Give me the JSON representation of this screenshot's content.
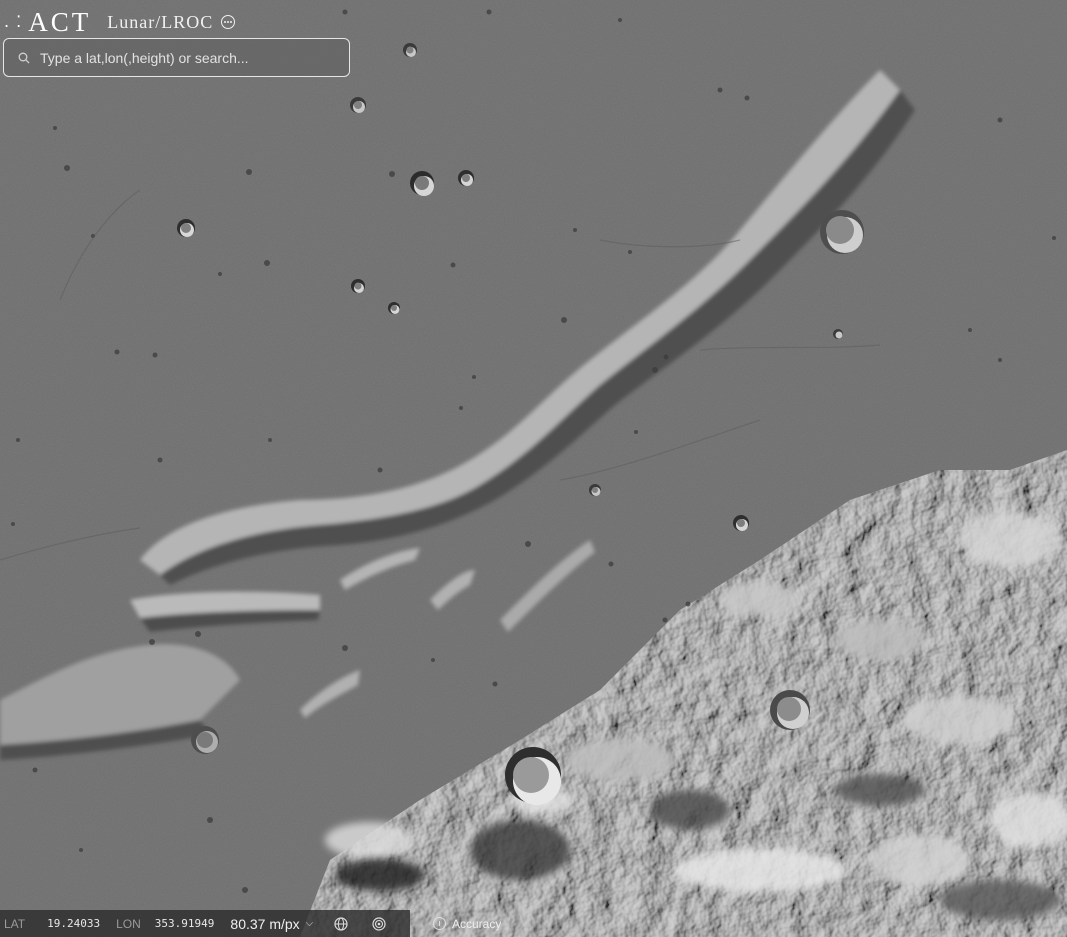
{
  "app": {
    "brand_mark": ". ⁚",
    "brand_name": "ACT",
    "layer_name": "Lunar/LROC",
    "layer_menu_icon": "more-circle-icon"
  },
  "search": {
    "placeholder": "Type a lat,lon(,height) or search...",
    "value": "",
    "icon": "search-icon"
  },
  "status": {
    "lat_label": "LAT",
    "lat_value": "19.24033",
    "lon_label": "LON",
    "lon_value": "353.91949",
    "scale_value": "80.37 m/px",
    "scale_caret": "⌵",
    "globe_icon": "globe-icon",
    "target_icon": "target-icon"
  },
  "accuracy": {
    "label": "Accuracy",
    "icon": "info-icon"
  },
  "colors": {
    "terrain_base": "#6e6e6e",
    "highlight": "#d9d9d9",
    "shadow": "#2a2a2a",
    "statusbar_bg": "#2d2d2d"
  }
}
